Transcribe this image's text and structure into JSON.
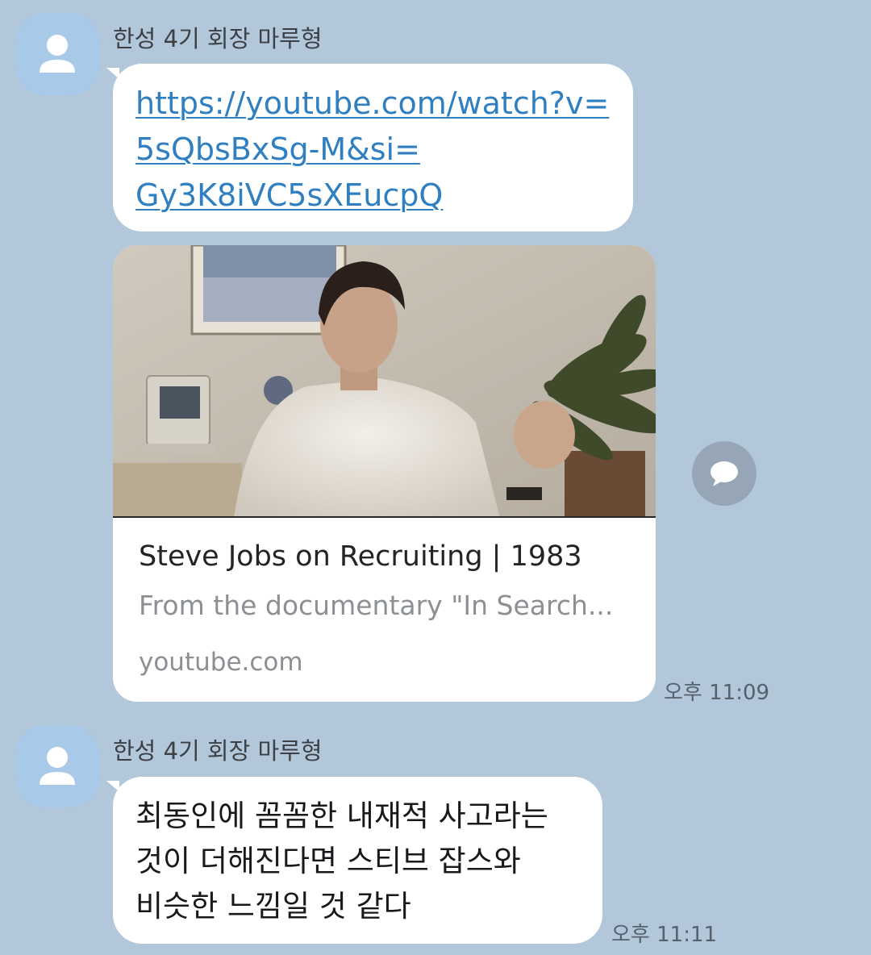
{
  "messages": [
    {
      "sender": "한성 4기 회장 마루형",
      "link_lines": [
        "https://youtube.com/watch?v=",
        "5sQbsBxSg-M&si=",
        "Gy3K8iVC5sXEucpQ"
      ],
      "preview": {
        "title": "Steve Jobs on Recruiting | 1983",
        "description": "From the documentary \"In Search...",
        "domain": "youtube.com"
      },
      "time": "오후 11:09"
    },
    {
      "sender": "한성 4기 회장 마루형",
      "text_lines": [
        "최동인에 꼼꼼한 내재적 사고라는",
        "것이 더해진다면 스티브 잡스와",
        "비슷한 느낌일 것 같다"
      ],
      "time": "오후 11:11"
    }
  ],
  "icons": {
    "avatar": "default-profile-icon",
    "share": "chat-bubble-icon"
  },
  "colors": {
    "background": "#b2c7da",
    "bubble": "#ffffff",
    "link": "#2f7fc1",
    "avatar": "#a9c9e8"
  }
}
